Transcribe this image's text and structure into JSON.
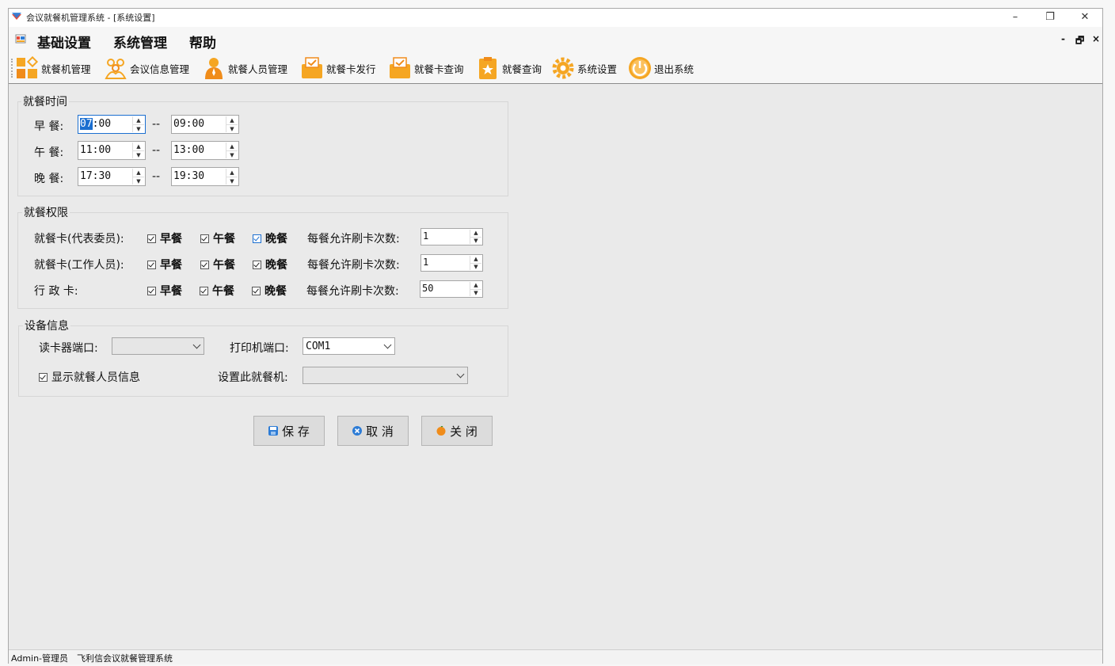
{
  "window": {
    "title": "会议就餐机管理系统 - [系统设置]",
    "controls": [
      "–",
      "❐",
      "✕"
    ]
  },
  "menu": {
    "items": [
      "基础设置",
      "系统管理",
      "帮助"
    ],
    "mdi_controls": [
      "-",
      "🗗",
      "×"
    ]
  },
  "toolbar": {
    "items": [
      {
        "label": "就餐机管理",
        "icon": "terminal-icon"
      },
      {
        "label": "会议信息管理",
        "icon": "people-icon"
      },
      {
        "label": "就餐人员管理",
        "icon": "person-icon"
      },
      {
        "label": "就餐卡发行",
        "icon": "card-issue-icon"
      },
      {
        "label": "就餐卡查询",
        "icon": "card-query-icon"
      },
      {
        "label": "就餐查询",
        "icon": "clipboard-star-icon"
      },
      {
        "label": "系统设置",
        "icon": "gear-icon"
      },
      {
        "label": "退出系统",
        "icon": "power-icon"
      }
    ]
  },
  "meal_time": {
    "title": "就餐时间",
    "rows": [
      {
        "label": "早 餐:",
        "start_sel": "07",
        "start_rest": ":00",
        "sep": "--",
        "end": "09:00"
      },
      {
        "label": "午 餐:",
        "start": "11:00",
        "sep": "--",
        "end": "13:00"
      },
      {
        "label": "晚 餐:",
        "start": "17:30",
        "sep": "--",
        "end": "19:30"
      }
    ]
  },
  "meal_permission": {
    "title": "就餐权限",
    "meal_labels": [
      "早餐",
      "午餐",
      "晚餐"
    ],
    "swipe_label": "每餐允许刷卡次数:",
    "rows": [
      {
        "label": "就餐卡(代表委员):",
        "checked": [
          true,
          true,
          true
        ],
        "swipes": "1"
      },
      {
        "label": "就餐卡(工作人员):",
        "checked": [
          true,
          true,
          true
        ],
        "swipes": "1"
      },
      {
        "label": "行 政 卡:",
        "checked": [
          true,
          true,
          true
        ],
        "swipes": "50"
      }
    ]
  },
  "device": {
    "title": "设备信息",
    "reader_port_label": "读卡器端口:",
    "reader_port_value": "",
    "printer_port_label": "打印机端口:",
    "printer_port_value": "COM1",
    "show_info_label": "显示就餐人员信息",
    "show_info_checked": true,
    "set_machine_label": "设置此就餐机:",
    "set_machine_value": ""
  },
  "buttons": {
    "save": "保 存",
    "cancel": "取 消",
    "close": "关 闭"
  },
  "status": {
    "user": "Admin-管理员",
    "company": "飞利信会议就餐管理系统"
  },
  "colors": {
    "accent": "#1c6fd0",
    "icon_orange": "#f5a623",
    "client_bg": "#eaeaea"
  }
}
